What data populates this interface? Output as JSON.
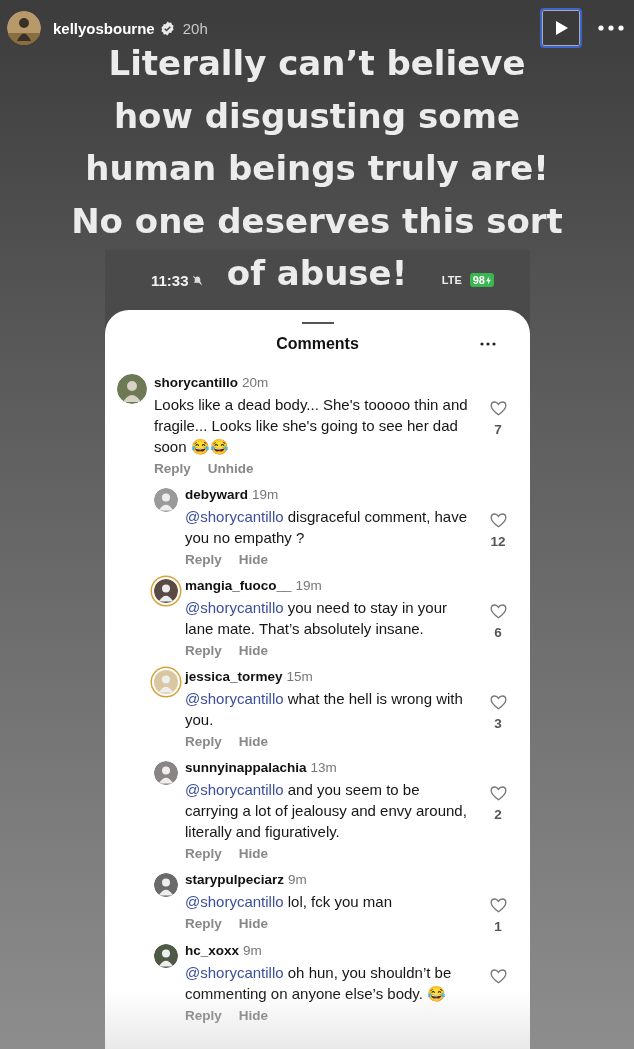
{
  "story": {
    "username": "kellyosbourne",
    "verified": true,
    "time": "20h"
  },
  "caption": {
    "lines": [
      "Literally can’t believe",
      "how disgusting some",
      "human beings truly are!",
      "No one deserves this sort",
      "of abuse!"
    ]
  },
  "status_bar": {
    "time": "11:33",
    "network": "LTE",
    "battery": "98"
  },
  "sheet": {
    "title": "Comments"
  },
  "comments": [
    {
      "username": "shorycantillo",
      "time": "20m",
      "text": "Looks like a dead body... She's tooooo thin and fragile... Looks like she's going to see her dad soon 😂😂",
      "likes": "7",
      "actions": [
        "Reply",
        "Unhide"
      ],
      "story_ring": false,
      "replies": [
        {
          "username": "debyward",
          "time": "19m",
          "mention": "@shorycantillo",
          "text": "disgraceful comment, have you no empathy ?",
          "likes": "12",
          "actions": [
            "Reply",
            "Hide"
          ],
          "story_ring": false
        },
        {
          "username": "mangia_fuoco__",
          "time": "19m",
          "mention": "@shorycantillo",
          "text": "you need to stay in your lane mate. That’s absolutely insane.",
          "likes": "6",
          "actions": [
            "Reply",
            "Hide"
          ],
          "story_ring": true
        },
        {
          "username": "jessica_tormey",
          "time": "15m",
          "mention": "@shorycantillo",
          "text": "what the hell is wrong with you.",
          "likes": "3",
          "actions": [
            "Reply",
            "Hide"
          ],
          "story_ring": true
        },
        {
          "username": "sunnyinappalachia",
          "time": "13m",
          "mention": "@shorycantillo",
          "text": "and you seem to be carrying a lot of jealousy and envy around, literally and figuratively.",
          "likes": "2",
          "actions": [
            "Reply",
            "Hide"
          ],
          "story_ring": false
        },
        {
          "username": "starypulpeciarz",
          "time": "9m",
          "mention": "@shorycantillo",
          "text": "lol, fck you man",
          "likes": "1",
          "actions": [
            "Reply",
            "Hide"
          ],
          "story_ring": false
        },
        {
          "username": "hc_xoxx",
          "time": "9m",
          "mention": "@shorycantillo",
          "text": "oh hun, you shouldn’t be commenting on anyone else’s body. 😂",
          "actions": [
            "Reply",
            "Hide"
          ],
          "story_ring": false
        }
      ]
    }
  ]
}
